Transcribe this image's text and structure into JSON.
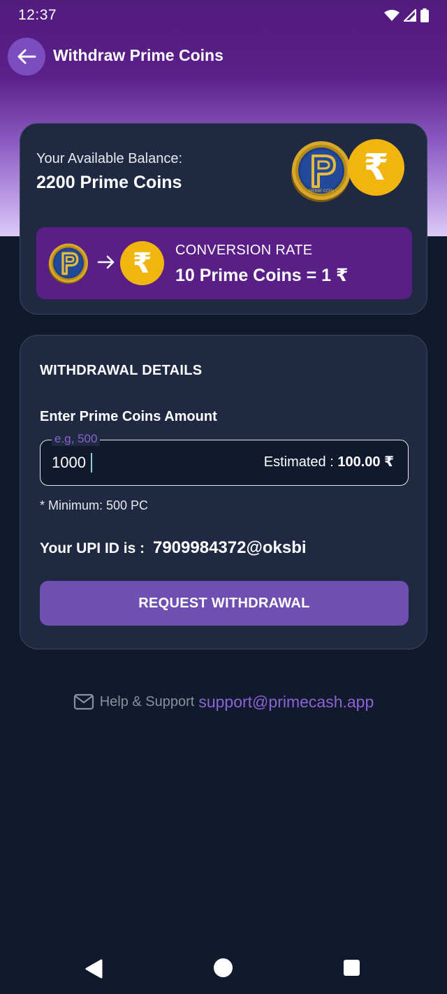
{
  "status_bar": {
    "time": "12:37",
    "icons": [
      "wifi-icon",
      "signal-icon",
      "battery-icon"
    ]
  },
  "app_bar": {
    "back_icon": "arrow-left-icon",
    "title": "Withdraw Prime Coins"
  },
  "balance_card": {
    "label": "Your Available Balance:",
    "value": "2200 Prime Coins",
    "coin_logo_text": "PRIME COIN",
    "currency_symbol": "₹",
    "conversion": {
      "arrow_icon": "arrow-right-icon",
      "title": "CONVERSION RATE",
      "value": "10 Prime Coins = 1 ₹"
    }
  },
  "withdrawal": {
    "section_title": "WITHDRAWAL DETAILS",
    "amount_label": "Enter Prime Coins Amount",
    "amount_placeholder": "e.g, 500",
    "amount_value": "1000",
    "estimate_label": "Estimated : ",
    "estimate_value": "100.00 ₹",
    "minimum_note": "* Minimum: 500 PC",
    "upi_label": "Your UPI ID is :",
    "upi_value": "7909984372@oksbi",
    "button_label": "REQUEST WITHDRAWAL"
  },
  "support": {
    "icon": "mail-icon",
    "label": "Help & Support",
    "email": "support@primecash.app"
  },
  "nav_bar": {
    "icons": [
      "nav-back-icon",
      "nav-home-icon",
      "nav-recents-icon"
    ]
  },
  "colors": {
    "header_purple": "#521b7e",
    "background": "#111a2d",
    "card": "#1f2a42",
    "conversion_box": "#5a1f86",
    "button": "#6f4fb2",
    "rupee_gold": "#f2b40f",
    "accent_link": "#8c63d6"
  }
}
